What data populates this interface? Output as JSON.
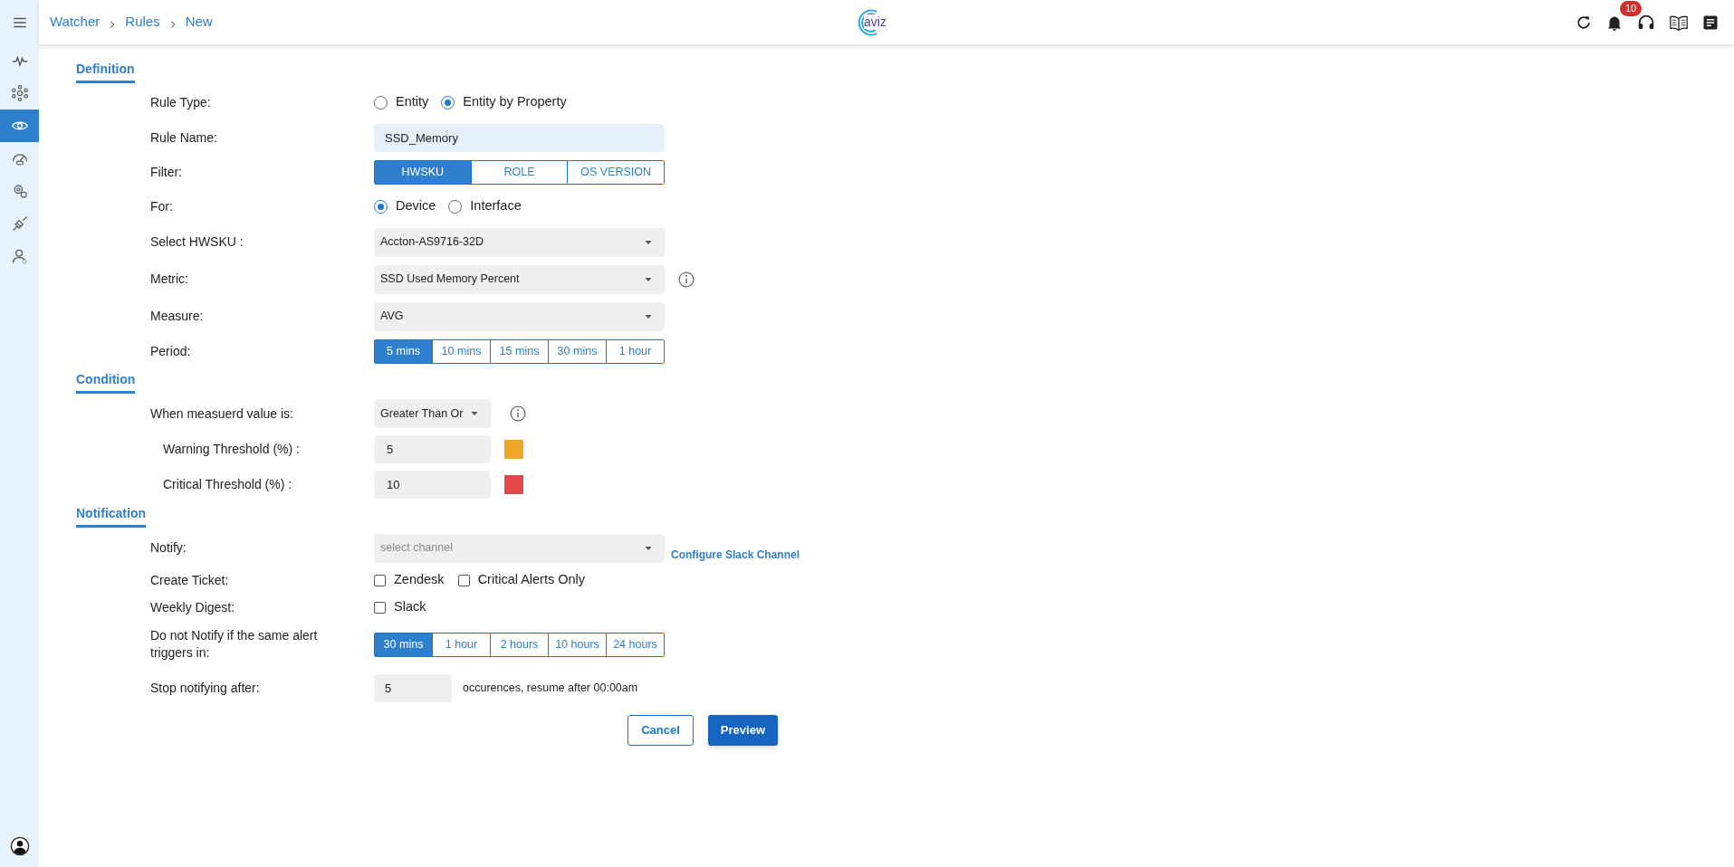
{
  "breadcrumb": [
    "Watcher",
    "Rules",
    "New"
  ],
  "logo": "aviz",
  "notifications": {
    "count": "10"
  },
  "sidebar": {
    "items": [
      {
        "selected": false
      },
      {
        "selected": false
      },
      {
        "selected": true
      },
      {
        "selected": false
      },
      {
        "selected": false
      },
      {
        "selected": false
      },
      {
        "selected": false
      }
    ]
  },
  "sections": [
    {
      "title": "Definition",
      "rows": [
        {
          "kind": "radio",
          "label": "Rule Type:",
          "options": [
            {
              "label": "Entity",
              "selected": false
            },
            {
              "label": "Entity by Property",
              "selected": true
            }
          ]
        },
        {
          "kind": "text",
          "label": "Rule Name:",
          "value": "SSD_Memory"
        },
        {
          "kind": "segmented",
          "label": "Filter:",
          "options": [
            {
              "label": "HWSKU",
              "selected": true
            },
            {
              "label": "ROLE",
              "selected": false
            },
            {
              "label": "OS VERSION",
              "selected": false
            }
          ]
        },
        {
          "kind": "radio",
          "label": "For:",
          "options": [
            {
              "label": "Device",
              "selected": true
            },
            {
              "label": "Interface",
              "selected": false
            }
          ]
        },
        {
          "kind": "select",
          "label": "Select HWSKU :",
          "value": "Accton-AS9716-32D"
        },
        {
          "kind": "select",
          "label": "Metric:",
          "value": "SSD Used Memory Percent",
          "info": true
        },
        {
          "kind": "select",
          "label": "Measure:",
          "value": "AVG"
        },
        {
          "kind": "segmented",
          "label": "Period:",
          "options": [
            {
              "label": "5 mins",
              "selected": true
            },
            {
              "label": "10 mins",
              "selected": false
            },
            {
              "label": "15 mins",
              "selected": false
            },
            {
              "label": "30 mins",
              "selected": false
            },
            {
              "label": "1 hour",
              "selected": false
            }
          ]
        }
      ]
    },
    {
      "title": "Condition",
      "rows": [
        {
          "kind": "short_select",
          "label": "When measuerd value is:",
          "value": "Greater Than Or",
          "info": true
        },
        {
          "kind": "threshold",
          "label": "Warning Threshold (%) :",
          "value": "5",
          "color": "#f2a626"
        },
        {
          "kind": "threshold",
          "label": "Critical Threshold (%) :",
          "value": "10",
          "color": "#e5454c"
        }
      ]
    },
    {
      "title": "Notification",
      "rows": [
        {
          "kind": "select",
          "label": "Notify:",
          "placeholder": "select channel",
          "link": "Configure Slack Channel"
        },
        {
          "kind": "checkbox",
          "label": "Create Ticket:",
          "options": [
            {
              "label": "Zendesk",
              "checked": false
            },
            {
              "label": "Critical Alerts Only",
              "checked": false
            }
          ]
        },
        {
          "kind": "checkbox",
          "label": "Weekly Digest:",
          "options": [
            {
              "label": "Slack",
              "checked": false
            }
          ]
        },
        {
          "kind": "segmented",
          "label": "Do not Notify if the same alert triggers in:",
          "options": [
            {
              "label": "30 mins",
              "selected": true
            },
            {
              "label": "1 hour",
              "selected": false
            },
            {
              "label": "2 hours",
              "selected": false
            },
            {
              "label": "10 hours",
              "selected": false
            },
            {
              "label": "24 hours",
              "selected": false
            }
          ]
        },
        {
          "kind": "count",
          "label": "Stop notifying after:",
          "value": "5",
          "suffix": "occurences, resume after 00:00am"
        }
      ]
    }
  ],
  "buttons": [
    {
      "label": "Cancel",
      "kind": "outline"
    },
    {
      "label": "Preview",
      "kind": "primary"
    }
  ]
}
